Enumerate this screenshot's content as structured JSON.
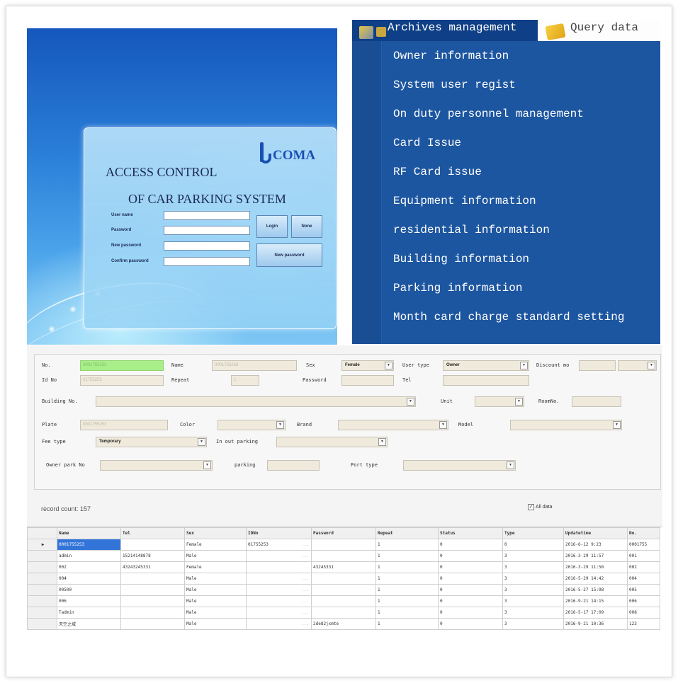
{
  "login": {
    "logo_text": "COMA",
    "title_line1": "ACCESS CONTROL",
    "title_line2": "OF CAR PARKING SYSTEM",
    "fields": [
      "User name",
      "Password",
      "New password",
      "Confirm password"
    ],
    "buttons": {
      "login": "Login",
      "none": "None",
      "new_password": "New password"
    }
  },
  "menu": {
    "tab_active": "Archives management",
    "tab_other": "Query data",
    "items": [
      "Owner information",
      "System user regist",
      "On duty personnel management",
      "Card Issue",
      "RF Card issue",
      "Equipment information",
      "residential information",
      "Building information",
      "Parking information",
      "Month card charge standard setting"
    ]
  },
  "form": {
    "labels": {
      "no": "No.",
      "name": "Name",
      "sex": "Sex",
      "user_type": "User type",
      "discount": "Discount mo",
      "id_no": "Id No",
      "repeat": "Repeat",
      "password": "Password",
      "tel": "Tel",
      "building_no": "Building No.",
      "unit": "Unit",
      "room_no": "RoomNo.",
      "plate": "Plate",
      "color": "Color",
      "brand": "Brand",
      "model": "Model",
      "fee_type": "Fee type",
      "in_out_parking": "In out parking",
      "owner_park_no": "Owner park No",
      "parking": "parking",
      "port_type": "Port type"
    },
    "values": {
      "no": "0001755253",
      "name": "0001755253",
      "sex": "Female",
      "user_type": "Owner",
      "id_no": "01755253",
      "repeat": "1",
      "plate": "0001755253",
      "fee_type": "Temporary"
    },
    "record_count": "record count: 157",
    "all_data": "All data"
  },
  "table": {
    "columns": [
      "Name",
      "Tel",
      "Sex",
      "IDNo",
      "Password",
      "Repeat",
      "Status",
      "Type",
      "Updatetime",
      "No."
    ],
    "rows": [
      [
        "0001755253",
        "",
        "Female",
        "01755253",
        "",
        "1",
        "0",
        "0",
        "2016-6-12 9:23",
        "0001755"
      ],
      [
        "admin",
        "15214148878",
        "Male",
        "",
        "",
        "1",
        "0",
        "3",
        "2016-3-29 11:57",
        "001"
      ],
      [
        "002",
        "43243245331",
        "Female",
        "",
        "43245331",
        "1",
        "0",
        "3",
        "2016-3-29 11:58",
        "002"
      ],
      [
        "004",
        "",
        "Male",
        "",
        "",
        "1",
        "0",
        "3",
        "2016-5-29 14:42",
        "004"
      ],
      [
        "00500",
        "",
        "Male",
        "",
        "",
        "1",
        "0",
        "3",
        "2016-5-27 15:08",
        "005"
      ],
      [
        "006",
        "",
        "Male",
        "",
        "",
        "1",
        "0",
        "3",
        "2016-9-21 14:15",
        "006"
      ],
      [
        "Tadmin",
        "",
        "Male",
        "",
        "",
        "1",
        "0",
        "3",
        "2016-5-17 17:09",
        "008"
      ],
      [
        "天空之城",
        "",
        "Male",
        "",
        "2de82jxmte",
        "1",
        "0",
        "3",
        "2016-9-21 10:36",
        "123"
      ]
    ]
  }
}
